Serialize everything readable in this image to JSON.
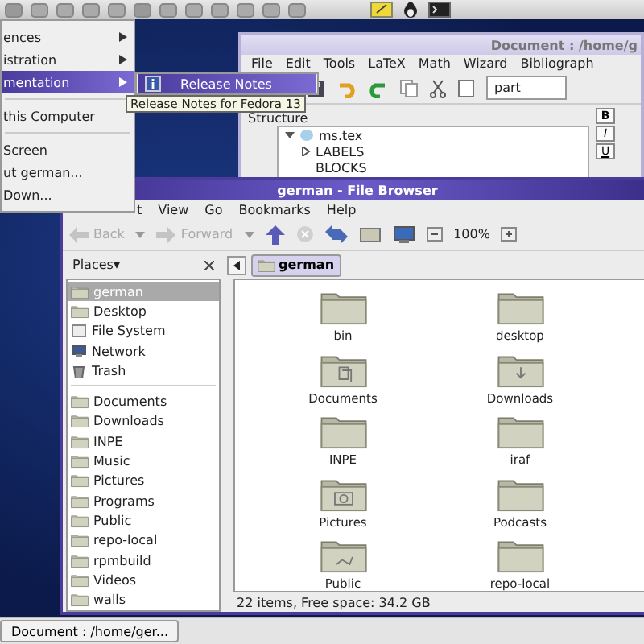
{
  "menu": {
    "items": [
      {
        "kind": "item",
        "label": "ences",
        "submenu": true,
        "selected": false
      },
      {
        "kind": "item",
        "label": "istration",
        "submenu": true,
        "selected": false
      },
      {
        "kind": "item",
        "label": "mentation",
        "submenu": true,
        "selected": true
      },
      {
        "kind": "separator"
      },
      {
        "kind": "item",
        "label": "this Computer",
        "submenu": false,
        "selected": false
      },
      {
        "kind": "separator"
      },
      {
        "kind": "item",
        "label": "Screen",
        "submenu": false,
        "selected": false
      },
      {
        "kind": "item",
        "label": "ut german...",
        "submenu": false,
        "selected": false
      },
      {
        "kind": "item",
        "label": "Down...",
        "submenu": false,
        "selected": false
      }
    ]
  },
  "submenu": {
    "items": [
      {
        "label": "Release Notes",
        "selected": true
      }
    ]
  },
  "tooltip": "Release Notes for Fedora 13",
  "editor_window": {
    "title": "Document : /home/g",
    "menu": [
      "File",
      "Edit",
      "Tools",
      "LaTeX",
      "Math",
      "Wizard",
      "Bibliograph"
    ],
    "combo": "part",
    "structure": {
      "title": "Structure",
      "tree": [
        {
          "label": "ms.tex",
          "expanded": true,
          "children": [
            {
              "label": "LABELS",
              "expanded": false
            },
            {
              "label": "BLOCKS"
            }
          ]
        }
      ]
    },
    "format_buttons": [
      "B",
      "I",
      "U"
    ]
  },
  "file_browser": {
    "title": "german - File Browser",
    "menu": [
      "t",
      "View",
      "Go",
      "Bookmarks",
      "Help"
    ],
    "toolbar": {
      "back": {
        "label": "Back",
        "disabled": true
      },
      "forward": {
        "label": "Forward",
        "disabled": true
      },
      "zoom": "100%"
    },
    "path": [
      {
        "label": "german",
        "selected": true
      }
    ],
    "sidebar": {
      "title": "Places",
      "toggle": "▾",
      "places": [
        {
          "label": "german",
          "kind": "home",
          "selected": true
        },
        {
          "label": "Desktop",
          "kind": "folder",
          "selected": false
        },
        {
          "label": "File System",
          "kind": "disk",
          "selected": false
        },
        {
          "label": "Network",
          "kind": "network",
          "selected": false
        },
        {
          "label": "Trash",
          "kind": "trash",
          "selected": false
        }
      ],
      "bookmarks": [
        {
          "label": "Documents",
          "selected": false
        },
        {
          "label": "Downloads",
          "selected": false
        },
        {
          "label": "INPE",
          "selected": false
        },
        {
          "label": "Music",
          "selected": false
        },
        {
          "label": "Pictures",
          "selected": false
        },
        {
          "label": "Programs",
          "selected": false
        },
        {
          "label": "Public",
          "selected": false
        },
        {
          "label": "repo-local",
          "selected": false
        },
        {
          "label": "rpmbuild",
          "selected": false
        },
        {
          "label": "Videos",
          "selected": false
        },
        {
          "label": "walls",
          "selected": false
        }
      ]
    },
    "items": [
      {
        "label": "bin",
        "kind": "plain"
      },
      {
        "label": "desktop",
        "kind": "plain"
      },
      {
        "label": "Documents",
        "kind": "documents"
      },
      {
        "label": "Downloads",
        "kind": "download"
      },
      {
        "label": "INPE",
        "kind": "plain"
      },
      {
        "label": "iraf",
        "kind": "plain"
      },
      {
        "label": "Pictures",
        "kind": "camera"
      },
      {
        "label": "Podcasts",
        "kind": "plain"
      },
      {
        "label": "Public",
        "kind": "share"
      },
      {
        "label": "repo-local",
        "kind": "plain"
      }
    ],
    "status": "22 items, Free space: 34.2 GB"
  },
  "taskbar": {
    "buttons": [
      "Document : /home/ger..."
    ]
  }
}
